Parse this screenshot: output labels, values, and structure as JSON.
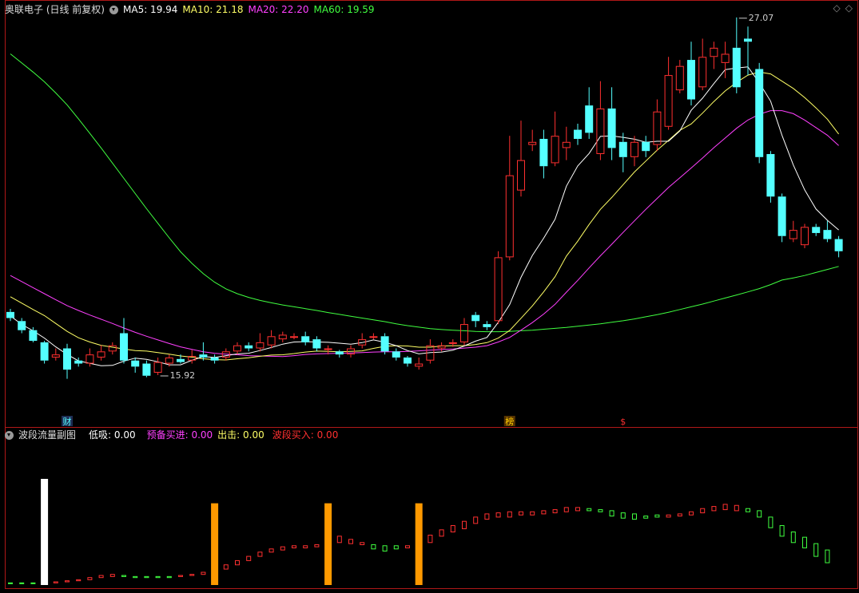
{
  "header": {
    "title": "奥联电子 (日线 前复权)",
    "indicators": [
      {
        "label": "MA5: 19.94",
        "color": "#ffffff"
      },
      {
        "label": "MA10: 21.18",
        "color": "#ffff66"
      },
      {
        "label": "MA20: 22.20",
        "color": "#ff40ff"
      },
      {
        "label": "MA60: 19.59",
        "color": "#40ff40"
      }
    ],
    "corner_icons": [
      "◇",
      "◇"
    ]
  },
  "sub_header": {
    "title": "波段流量副图",
    "indicators": [
      {
        "label": "低吸: 0.00",
        "color": "#ffffff"
      },
      {
        "label": "预备买进: 0.00",
        "color": "#ff40ff"
      },
      {
        "label": "出击: 0.00",
        "color": "#ffff66"
      },
      {
        "label": "波段买入: 0.00",
        "color": "#ff3030"
      }
    ]
  },
  "colors": {
    "up": "#ff3030",
    "down": "#54ffff",
    "ma5": "#ffffff",
    "ma10": "#ffff66",
    "ma20": "#ff40ff",
    "ma60": "#40ff40",
    "frame": "#b01818",
    "sub_white": "#ffffff",
    "sub_orange": "#ff9900",
    "sub_red": "#ff3030",
    "sub_green": "#40ff40"
  },
  "chart_data": {
    "type": "candlestick",
    "ylim": [
      15.0,
      27.8
    ],
    "candles": [
      [
        18.0,
        17.8,
        18.1,
        17.7
      ],
      [
        17.7,
        17.4,
        17.8,
        17.3
      ],
      [
        17.4,
        17.05,
        17.5,
        17.0
      ],
      [
        17.0,
        16.4,
        17.05,
        16.3
      ],
      [
        16.5,
        16.6,
        16.8,
        16.4
      ],
      [
        16.8,
        16.1,
        16.95,
        15.8
      ],
      [
        16.4,
        16.3,
        16.5,
        16.2
      ],
      [
        16.3,
        16.6,
        16.8,
        16.2
      ],
      [
        16.5,
        16.7,
        16.9,
        16.4
      ],
      [
        16.7,
        16.9,
        17.0,
        16.6
      ],
      [
        17.3,
        16.4,
        17.8,
        16.3
      ],
      [
        16.4,
        16.2,
        16.5,
        16.0
      ],
      [
        16.3,
        15.9,
        16.4,
        15.85
      ],
      [
        16.0,
        16.35,
        16.5,
        15.92
      ],
      [
        16.3,
        16.5,
        16.6,
        16.2
      ],
      [
        16.45,
        16.35,
        16.6,
        16.3
      ],
      [
        16.4,
        16.55,
        16.75,
        16.3
      ],
      [
        16.6,
        16.5,
        17.0,
        16.4
      ],
      [
        16.5,
        16.4,
        16.6,
        16.3
      ],
      [
        16.5,
        16.7,
        16.8,
        16.4
      ],
      [
        16.7,
        16.9,
        17.0,
        16.6
      ],
      [
        16.9,
        16.8,
        17.0,
        16.7
      ],
      [
        16.8,
        17.0,
        17.3,
        16.7
      ],
      [
        16.9,
        17.2,
        17.4,
        16.8
      ],
      [
        17.1,
        17.25,
        17.35,
        17.0
      ],
      [
        17.2,
        17.2,
        17.3,
        17.1
      ],
      [
        17.2,
        17.0,
        17.35,
        16.9
      ],
      [
        17.1,
        16.8,
        17.2,
        16.7
      ],
      [
        16.8,
        16.8,
        16.9,
        16.6
      ],
      [
        16.7,
        16.6,
        16.75,
        16.5
      ],
      [
        16.6,
        16.8,
        16.9,
        16.5
      ],
      [
        16.9,
        17.1,
        17.3,
        16.8
      ],
      [
        17.2,
        17.2,
        17.3,
        17.1
      ],
      [
        17.2,
        16.7,
        17.3,
        16.6
      ],
      [
        16.7,
        16.5,
        16.8,
        16.4
      ],
      [
        16.5,
        16.3,
        16.55,
        16.2
      ],
      [
        16.2,
        16.3,
        16.5,
        16.1
      ],
      [
        16.4,
        16.9,
        17.1,
        16.3
      ],
      [
        16.8,
        16.9,
        17.0,
        16.7
      ],
      [
        16.95,
        17.0,
        17.1,
        16.85
      ],
      [
        17.0,
        17.6,
        17.8,
        16.9
      ],
      [
        17.9,
        17.7,
        18.0,
        17.5
      ],
      [
        17.6,
        17.5,
        17.7,
        17.4
      ],
      [
        17.7,
        19.8,
        20.0,
        17.6
      ],
      [
        19.8,
        22.5,
        23.8,
        19.7
      ],
      [
        22.0,
        23.0,
        24.3,
        21.8
      ],
      [
        23.5,
        23.6,
        24.0,
        23.3
      ],
      [
        23.7,
        22.8,
        24.0,
        22.4
      ],
      [
        22.9,
        23.8,
        24.6,
        22.8
      ],
      [
        23.4,
        23.6,
        24.1,
        23.0
      ],
      [
        24.0,
        23.7,
        24.2,
        23.5
      ],
      [
        24.8,
        23.9,
        25.4,
        23.7
      ],
      [
        23.2,
        24.7,
        25.6,
        23.0
      ],
      [
        24.7,
        23.4,
        25.4,
        23.0
      ],
      [
        23.6,
        23.1,
        23.9,
        22.6
      ],
      [
        23.1,
        23.6,
        23.8,
        22.8
      ],
      [
        23.6,
        23.3,
        23.8,
        23.1
      ],
      [
        23.5,
        24.6,
        25.0,
        23.3
      ],
      [
        24.1,
        25.8,
        26.4,
        24.0
      ],
      [
        25.3,
        26.1,
        26.3,
        25.2
      ],
      [
        26.3,
        25.0,
        26.9,
        24.8
      ],
      [
        25.4,
        26.4,
        27.0,
        25.3
      ],
      [
        26.4,
        26.7,
        26.9,
        26.0
      ],
      [
        26.2,
        26.5,
        26.9,
        25.7
      ],
      [
        26.7,
        25.4,
        27.7,
        25.2
      ],
      [
        27.0,
        26.9,
        27.4,
        25.8
      ],
      [
        26.0,
        23.1,
        26.2,
        22.9
      ],
      [
        23.2,
        21.8,
        23.3,
        21.6
      ],
      [
        21.8,
        20.5,
        21.9,
        20.3
      ],
      [
        20.4,
        20.7,
        21.0,
        20.3
      ],
      [
        20.2,
        20.8,
        20.9,
        20.1
      ],
      [
        20.8,
        20.6,
        20.9,
        20.5
      ],
      [
        20.7,
        20.4,
        21.0,
        20.3
      ],
      [
        20.4,
        20.0,
        20.5,
        19.8
      ]
    ],
    "ma5": [
      17.87,
      17.59,
      17.38,
      17.14,
      16.85,
      16.6,
      16.39,
      16.31,
      16.23,
      16.24,
      16.38,
      16.48,
      16.44,
      16.36,
      16.26,
      16.26,
      16.41,
      16.53,
      16.5,
      16.56,
      16.62,
      16.64,
      16.73,
      16.83,
      16.94,
      17.01,
      17.02,
      17.01,
      17.0,
      16.97,
      16.94,
      16.99,
      17.08,
      17.0,
      16.89,
      16.73,
      16.62,
      16.66,
      16.68,
      16.74,
      16.88,
      17.04,
      17.16,
      17.66,
      18.24,
      19.14,
      19.86,
      20.43,
      21.05,
      22.14,
      22.81,
      23.22,
      23.78,
      23.8,
      23.75,
      23.69,
      23.59,
      23.62,
      23.62,
      23.96,
      24.64,
      25.04,
      25.52,
      25.98,
      26.03,
      26.07,
      25.55,
      24.94,
      23.82,
      22.84,
      22.02,
      21.39,
      21.02,
      20.7
    ],
    "ma10": [
      18.5,
      18.29,
      18.08,
      17.88,
      17.62,
      17.36,
      17.15,
      17.01,
      16.9,
      16.84,
      16.78,
      16.73,
      16.71,
      16.66,
      16.61,
      16.55,
      16.51,
      16.46,
      16.43,
      16.42,
      16.46,
      16.49,
      16.54,
      16.58,
      16.59,
      16.63,
      16.68,
      16.71,
      16.7,
      16.69,
      16.7,
      16.72,
      16.8,
      16.87,
      16.89,
      16.88,
      16.84,
      16.84,
      16.88,
      16.89,
      16.89,
      16.93,
      16.99,
      17.14,
      17.39,
      17.79,
      18.2,
      18.66,
      19.16,
      19.84,
      20.33,
      20.88,
      21.38,
      21.77,
      22.19,
      22.61,
      22.97,
      23.33,
      23.65,
      23.98,
      24.19,
      24.55,
      24.93,
      25.28,
      25.56,
      25.8,
      25.9,
      25.84,
      25.6,
      25.36,
      25.06,
      24.72,
      24.35,
      23.86
    ],
    "ma20": [
      19.2,
      19.0,
      18.8,
      18.6,
      18.4,
      18.21,
      18.05,
      17.9,
      17.76,
      17.62,
      17.47,
      17.33,
      17.2,
      17.08,
      16.96,
      16.85,
      16.77,
      16.69,
      16.64,
      16.61,
      16.59,
      16.56,
      16.55,
      16.54,
      16.53,
      16.56,
      16.6,
      16.62,
      16.63,
      16.64,
      16.65,
      16.66,
      16.68,
      16.69,
      16.69,
      16.7,
      16.72,
      16.74,
      16.76,
      16.78,
      16.81,
      16.84,
      16.89,
      17.01,
      17.16,
      17.4,
      17.65,
      17.93,
      18.25,
      18.65,
      19.04,
      19.45,
      19.85,
      20.23,
      20.62,
      21.0,
      21.38,
      21.74,
      22.1,
      22.42,
      22.74,
      23.07,
      23.41,
      23.73,
      24.05,
      24.32,
      24.51,
      24.63,
      24.63,
      24.53,
      24.32,
      24.07,
      23.82,
      23.48
    ],
    "ma60": [
      26.5,
      26.2,
      25.9,
      25.58,
      25.21,
      24.82,
      24.36,
      23.88,
      23.4,
      22.9,
      22.4,
      21.9,
      21.4,
      20.92,
      20.44,
      19.98,
      19.6,
      19.26,
      18.98,
      18.76,
      18.6,
      18.48,
      18.38,
      18.3,
      18.23,
      18.17,
      18.11,
      18.05,
      17.98,
      17.92,
      17.86,
      17.8,
      17.74,
      17.68,
      17.61,
      17.55,
      17.5,
      17.45,
      17.42,
      17.4,
      17.38,
      17.36,
      17.35,
      17.35,
      17.36,
      17.38,
      17.4,
      17.43,
      17.46,
      17.49,
      17.53,
      17.57,
      17.61,
      17.66,
      17.71,
      17.77,
      17.84,
      17.91,
      17.99,
      18.08,
      18.17,
      18.26,
      18.36,
      18.46,
      18.56,
      18.66,
      18.77,
      18.9,
      19.05,
      19.12,
      19.2,
      19.3,
      19.4,
      19.5
    ],
    "annotations": [
      {
        "text": "27.07",
        "index": 64,
        "value": 27.7
      },
      {
        "text": "15.92",
        "index": 13,
        "value": 15.92
      }
    ],
    "markers": [
      {
        "text": "财",
        "index": 5,
        "color": "#54ffff",
        "bg": "#1e2e55"
      },
      {
        "text": "榜",
        "index": 44,
        "color": "#ffcc00",
        "bg": "#553300"
      },
      {
        "text": "$",
        "index": 54,
        "color": "#ff3030",
        "bg": ""
      }
    ],
    "sub": {
      "ylim": [
        0,
        100
      ],
      "bars": [
        [
          1.5,
          2,
          "green"
        ],
        [
          1.5,
          2,
          "green"
        ],
        [
          1.5,
          2,
          "green"
        ],
        [
          0,
          100,
          "white"
        ],
        [
          2,
          3,
          "red"
        ],
        [
          3,
          4,
          "red"
        ],
        [
          4,
          5,
          "red"
        ],
        [
          5,
          7,
          "red"
        ],
        [
          7,
          9,
          "red"
        ],
        [
          8,
          10,
          "red"
        ],
        [
          8,
          9,
          "green"
        ],
        [
          7,
          8,
          "green"
        ],
        [
          7,
          8,
          "green"
        ],
        [
          7,
          8,
          "green"
        ],
        [
          7,
          8,
          "green"
        ],
        [
          8,
          9,
          "red"
        ],
        [
          9,
          10,
          "red"
        ],
        [
          10,
          12,
          "red"
        ],
        [
          0,
          77,
          "orange"
        ],
        [
          15,
          19,
          "red"
        ],
        [
          19,
          23,
          "red"
        ],
        [
          23,
          27,
          "red"
        ],
        [
          27,
          31,
          "red"
        ],
        [
          31,
          34,
          "red"
        ],
        [
          33,
          36,
          "red"
        ],
        [
          35,
          37,
          "red"
        ],
        [
          35,
          37,
          "red"
        ],
        [
          36,
          38,
          "red"
        ],
        [
          0,
          77,
          "orange"
        ],
        [
          40,
          46,
          "red"
        ],
        [
          39,
          43,
          "red"
        ],
        [
          38,
          40,
          "red"
        ],
        [
          34,
          38,
          "green"
        ],
        [
          32,
          37,
          "green"
        ],
        [
          34,
          37,
          "green"
        ],
        [
          35,
          37,
          "red"
        ],
        [
          0,
          77,
          "orange"
        ],
        [
          40,
          47,
          "red"
        ],
        [
          46,
          52,
          "red"
        ],
        [
          50,
          56,
          "red"
        ],
        [
          53,
          60,
          "red"
        ],
        [
          58,
          64,
          "red"
        ],
        [
          62,
          67,
          "red"
        ],
        [
          64,
          68,
          "red"
        ],
        [
          64,
          69,
          "red"
        ],
        [
          66,
          69,
          "red"
        ],
        [
          66,
          69,
          "red"
        ],
        [
          67,
          70,
          "red"
        ],
        [
          68,
          71,
          "red"
        ],
        [
          69,
          73,
          "red"
        ],
        [
          70,
          73,
          "red"
        ],
        [
          70,
          72,
          "green"
        ],
        [
          69,
          71,
          "green"
        ],
        [
          65,
          70,
          "green"
        ],
        [
          63,
          68,
          "green"
        ],
        [
          62,
          67,
          "green"
        ],
        [
          63,
          65,
          "green"
        ],
        [
          64,
          66,
          "green"
        ],
        [
          64,
          66,
          "red"
        ],
        [
          65,
          67,
          "red"
        ],
        [
          66,
          69,
          "red"
        ],
        [
          68,
          72,
          "red"
        ],
        [
          70,
          74,
          "red"
        ],
        [
          71,
          76,
          "red"
        ],
        [
          70,
          75,
          "red"
        ],
        [
          69,
          72,
          "green"
        ],
        [
          64,
          70,
          "green"
        ],
        [
          54,
          64,
          "green"
        ],
        [
          46,
          56,
          "green"
        ],
        [
          40,
          50,
          "green"
        ],
        [
          35,
          45,
          "green"
        ],
        [
          27,
          39,
          "green"
        ],
        [
          21,
          33,
          "green"
        ]
      ]
    }
  }
}
